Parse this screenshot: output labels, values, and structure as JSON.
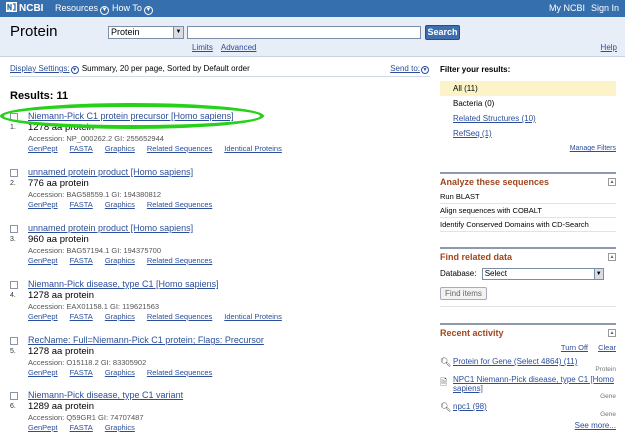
{
  "topbar": {
    "logo": "NCBI",
    "resources": "Resources",
    "howto": "How To",
    "mync": "My NCBI",
    "signin": "Sign In"
  },
  "search": {
    "db_title": "Protein",
    "db_select": "Protein",
    "term_value": "",
    "button": "Search",
    "limits": "Limits",
    "advanced": "Advanced",
    "help": "Help"
  },
  "display": {
    "settings": "Display Settings:",
    "summary": "Summary, 20 per page, Sorted by Default order",
    "sendto": "Send to:"
  },
  "results_title": "Results: 11",
  "items": [
    {
      "num": "1.",
      "title": "Niemann-Pick C1 protein precursor [Homo sapiens]",
      "size": "1278 aa protein",
      "acc": "Accession: NP_000262.2   GI: 255652944",
      "links": [
        "GenPept",
        "FASTA",
        "Graphics",
        "Related Sequences",
        "Identical Proteins"
      ]
    },
    {
      "num": "2.",
      "title": "unnamed protein product [Homo sapiens]",
      "size": "776 aa protein",
      "acc": "Accession: BAG58559.1   GI: 194380812",
      "links": [
        "GenPept",
        "FASTA",
        "Graphics",
        "Related Sequences"
      ]
    },
    {
      "num": "3.",
      "title": "unnamed protein product [Homo sapiens]",
      "size": "960 aa protein",
      "acc": "Accession: BAG57194.1   GI: 194375700",
      "links": [
        "GenPept",
        "FASTA",
        "Graphics",
        "Related Sequences"
      ]
    },
    {
      "num": "4.",
      "title": "Niemann-Pick disease, type C1 [Homo sapiens]",
      "size": "1278 aa protein",
      "acc": "Accession: EAX01158.1   GI: 119621563",
      "links": [
        "GenPept",
        "FASTA",
        "Graphics",
        "Related Sequences",
        "Identical Proteins"
      ]
    },
    {
      "num": "5.",
      "title": "RecName: Full=Niemann-Pick C1 protein; Flags: Precursor",
      "size": "1278 aa protein",
      "acc": "Accession: O15118.2   GI: 83305902",
      "links": [
        "GenPept",
        "FASTA",
        "Graphics",
        "Related Sequences"
      ]
    },
    {
      "num": "6.",
      "title": "Niemann-Pick disease, type C1 variant",
      "size": "1289 aa protein",
      "acc": "Accession: Q59GR1   GI: 74707487",
      "links": [
        "GenPept",
        "FASTA",
        "Graphics"
      ]
    }
  ],
  "filter": {
    "heading": "Filter your results:",
    "items": [
      "All (11)",
      "Bacteria (0)",
      "Related Structures (10)",
      "RefSeq (1)"
    ],
    "manage": "Manage Filters"
  },
  "analyze": {
    "heading": "Analyze these sequences",
    "links": [
      "Run BLAST",
      "Align sequences with COBALT",
      "Identify Conserved Domains with CD-Search"
    ]
  },
  "related": {
    "heading": "Find related data",
    "db_label": "Database:",
    "db_value": "Select",
    "button": "Find items"
  },
  "recent": {
    "heading": "Recent activity",
    "turn_off": "Turn Off",
    "clear": "Clear",
    "items": [
      {
        "text": "Protein for Gene (Select 4864) (11)",
        "tag": "Protein"
      },
      {
        "text": "NPC1 Niemann-Pick disease, type C1 [Homo sapiens]",
        "tag": "Gene"
      },
      {
        "text": "npc1 (98)",
        "tag": "Gene"
      }
    ],
    "see_more": "See more..."
  },
  "colors": {
    "topbar": "#366fae",
    "highlight": "#27d11a",
    "link": "#2b4e9c",
    "section_heading": "#a0461e"
  }
}
